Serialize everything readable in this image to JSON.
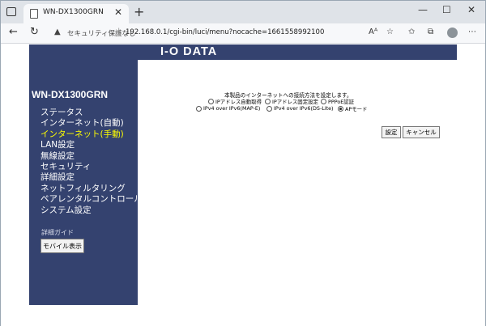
{
  "browser": {
    "tab_title": "WN-DX1300GRN",
    "security_label": "セキュリティ保護なし",
    "url": "192.168.0.1/cgi-bin/luci/menu?nocache=1661558992100",
    "reader_label": "Aᴬ"
  },
  "sidebar": {
    "device_name": "WN-DX1300GRN",
    "menu_items": [
      "ステータス",
      "インターネット(自動)",
      "インターネット(手動)",
      "LAN設定",
      "無線設定",
      "セキュリティ",
      "詳細設定",
      "ネットフィルタリング",
      "ペアレンタルコントロール",
      "システム設定"
    ],
    "active_index": 2,
    "detail_guide_label": "詳細ガイド",
    "mobile_button_label": "モバイル表示"
  },
  "brand": {
    "logo_text": "I-O DATA"
  },
  "main": {
    "instruction": "本製品のインターネットへの接続方法を設定します。",
    "options": [
      "IPアドレス自動取得",
      "IPアドレス固定設定",
      "PPPoE認証",
      "IPv4 over IPv6(MAP-E)",
      "IPv4 over IPv6(DS-Lite)",
      "APモード"
    ],
    "selected_index": 5,
    "set_button_label": "設定",
    "cancel_button_label": "キャンセル"
  },
  "colors": {
    "sidebar_bg": "#34426f",
    "active_menu": "#ffff00"
  }
}
